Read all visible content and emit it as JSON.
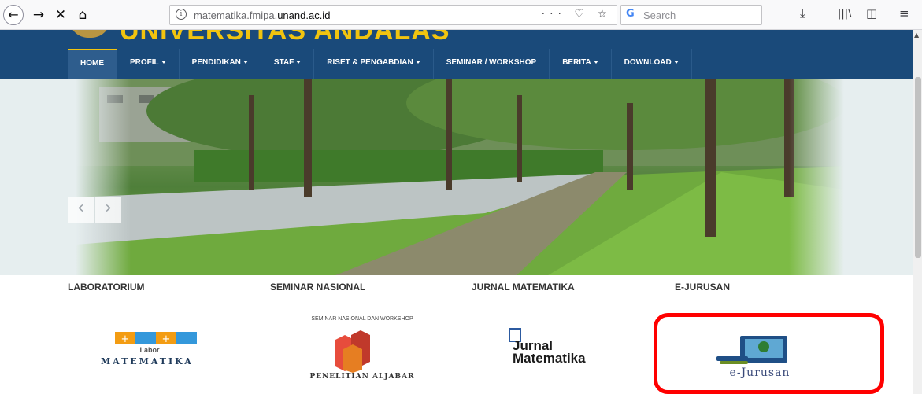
{
  "browser": {
    "url_prefix": "matematika.fmipa.",
    "url_domain": "unand.ac.id",
    "url_actions": "··· ♡ ☆",
    "search_placeholder": "Search"
  },
  "site": {
    "university_name": "UNIVERSITAS ANDALAS",
    "menu": [
      {
        "label": "HOME",
        "active": true
      },
      {
        "label": "PROFIL",
        "dropdown": true
      },
      {
        "label": "PENDIDIKAN",
        "dropdown": true
      },
      {
        "label": "STAF",
        "dropdown": true
      },
      {
        "label": "RISET & PENGABDIAN",
        "dropdown": true
      },
      {
        "label": "SEMINAR / WORKSHOP",
        "dropdown": false
      },
      {
        "label": "BERITA",
        "dropdown": true
      },
      {
        "label": "DOWNLOAD",
        "dropdown": true
      }
    ]
  },
  "slider": {
    "prev_glyph": "‹",
    "next_glyph": "›"
  },
  "quick_links": [
    {
      "title": "LABORATORIUM",
      "logo": {
        "line1": "Labor",
        "line2": "MATEMATIKA"
      }
    },
    {
      "title": "SEMINAR NASIONAL",
      "logo": {
        "caption_top": "SEMINAR NASIONAL DAN WORKSHOP",
        "caption_bottom": "PENELITIAN ALJABAR"
      }
    },
    {
      "title": "JURNAL MATEMATIKA",
      "logo": {
        "line1": "Jurnal",
        "line2": "Matematika"
      }
    },
    {
      "title": "E-JURUSAN",
      "logo": {
        "text": "e-Jurusan"
      }
    }
  ],
  "colors": {
    "nav_bg": "#1a4a7a",
    "univ_name": "#f1c40f",
    "highlight": "#ff0000"
  }
}
